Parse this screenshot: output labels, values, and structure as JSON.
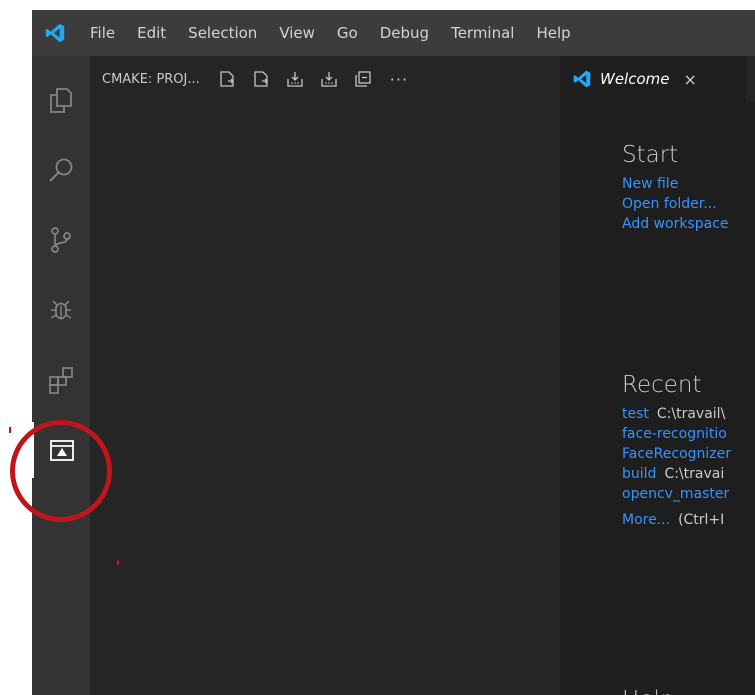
{
  "menubar": {
    "items": [
      "File",
      "Edit",
      "Selection",
      "View",
      "Go",
      "Debug",
      "Terminal",
      "Help"
    ]
  },
  "activitybar": {
    "items": [
      {
        "name": "explorer",
        "icon": "files-icon"
      },
      {
        "name": "search",
        "icon": "search-icon"
      },
      {
        "name": "source-control",
        "icon": "git-branch-icon"
      },
      {
        "name": "debug",
        "icon": "bug-icon"
      },
      {
        "name": "extensions",
        "icon": "extensions-icon"
      },
      {
        "name": "cmake",
        "icon": "cmake-icon",
        "active": true
      }
    ]
  },
  "sidebar": {
    "title": "CMAKE: PROJ...",
    "toolbar_icons": [
      "new-file-icon",
      "new-file-icon",
      "build-icon",
      "build-icon",
      "collapse-all-icon"
    ],
    "more": "···"
  },
  "editor": {
    "tab": {
      "label": "Welcome",
      "close": "×"
    },
    "welcome": {
      "start_title": "Start",
      "start_links": [
        "New file",
        "Open folder...",
        "Add workspace"
      ],
      "recent_title": "Recent",
      "recent": [
        {
          "name": "test",
          "path": "C:\\travail\\"
        },
        {
          "name": "face-recognitio",
          "path": ""
        },
        {
          "name": "FaceRecognizer",
          "path": ""
        },
        {
          "name": "build",
          "path": "C:\\travai"
        },
        {
          "name": "opencv_master",
          "path": ""
        }
      ],
      "more_label": "More...",
      "more_hint": "(Ctrl+I",
      "bottom_title": "Help"
    }
  },
  "colors": {
    "menubar": "#3c3c3c",
    "activitybar": "#333333",
    "sidebar": "#252526",
    "editor": "#1e1e1e",
    "link": "#3794ff",
    "vscode_blue": "#23a9f2",
    "highlight": "#c0151b"
  }
}
